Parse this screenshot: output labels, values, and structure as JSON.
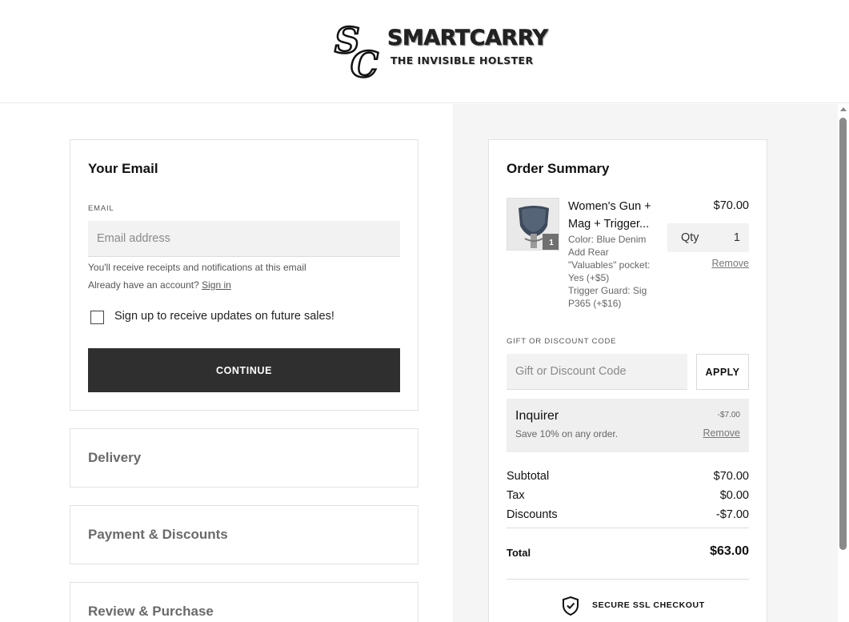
{
  "brand": {
    "logo_text": "SMARTCARRY",
    "tagline": "THE INVISIBLE HOLSTER",
    "monogram": "SC"
  },
  "email_section": {
    "title": "Your Email",
    "field_label": "EMAIL",
    "field_value": "",
    "placeholder": "Email address",
    "helper_text": "You'll receive receipts and notifications at this email",
    "account_prompt": "Already have an account?",
    "sign_in_link": "Sign in",
    "newsletter_checkbox_label": "Sign up to receive updates on future sales!",
    "newsletter_checked": false,
    "continue_label": "CONTINUE"
  },
  "steps": [
    {
      "label": "Delivery"
    },
    {
      "label": "Payment & Discounts"
    },
    {
      "label": "Review & Purchase"
    }
  ],
  "order_summary": {
    "title": "Order Summary",
    "item": {
      "name": "Women's Gun + Mag + Trigger...",
      "quantity_badge": "1",
      "price": "$70.00",
      "options": [
        "Color: Blue Denim",
        "Add Rear \"Valuables\" pocket: Yes (+$5)",
        "Trigger Guard: Sig P365 (+$16)"
      ],
      "qty_label": "Qty",
      "qty_value": "1",
      "remove_label": "Remove"
    },
    "discount": {
      "label": "GIFT OR DISCOUNT CODE",
      "placeholder": "Gift or Discount Code",
      "value": "",
      "apply_label": "APPLY",
      "applied": {
        "name": "Inquirer",
        "description": "Save 10% on any order.",
        "amount": "-$7.00",
        "remove_label": "Remove"
      }
    },
    "totals": {
      "subtotal_label": "Subtotal",
      "subtotal": "$70.00",
      "tax_label": "Tax",
      "tax": "$0.00",
      "discounts_label": "Discounts",
      "discounts": "-$7.00",
      "total_label": "Total",
      "total": "$63.00"
    },
    "secure_label": "SECURE SSL CHECKOUT"
  },
  "colors": {
    "primary_button": "#2f2f2f",
    "summary_background": "#f5f5f5",
    "input_background": "#f2f2f2"
  },
  "icons": [
    "shield-check-icon",
    "checkbox-icon",
    "scroll-up-arrow-icon"
  ]
}
